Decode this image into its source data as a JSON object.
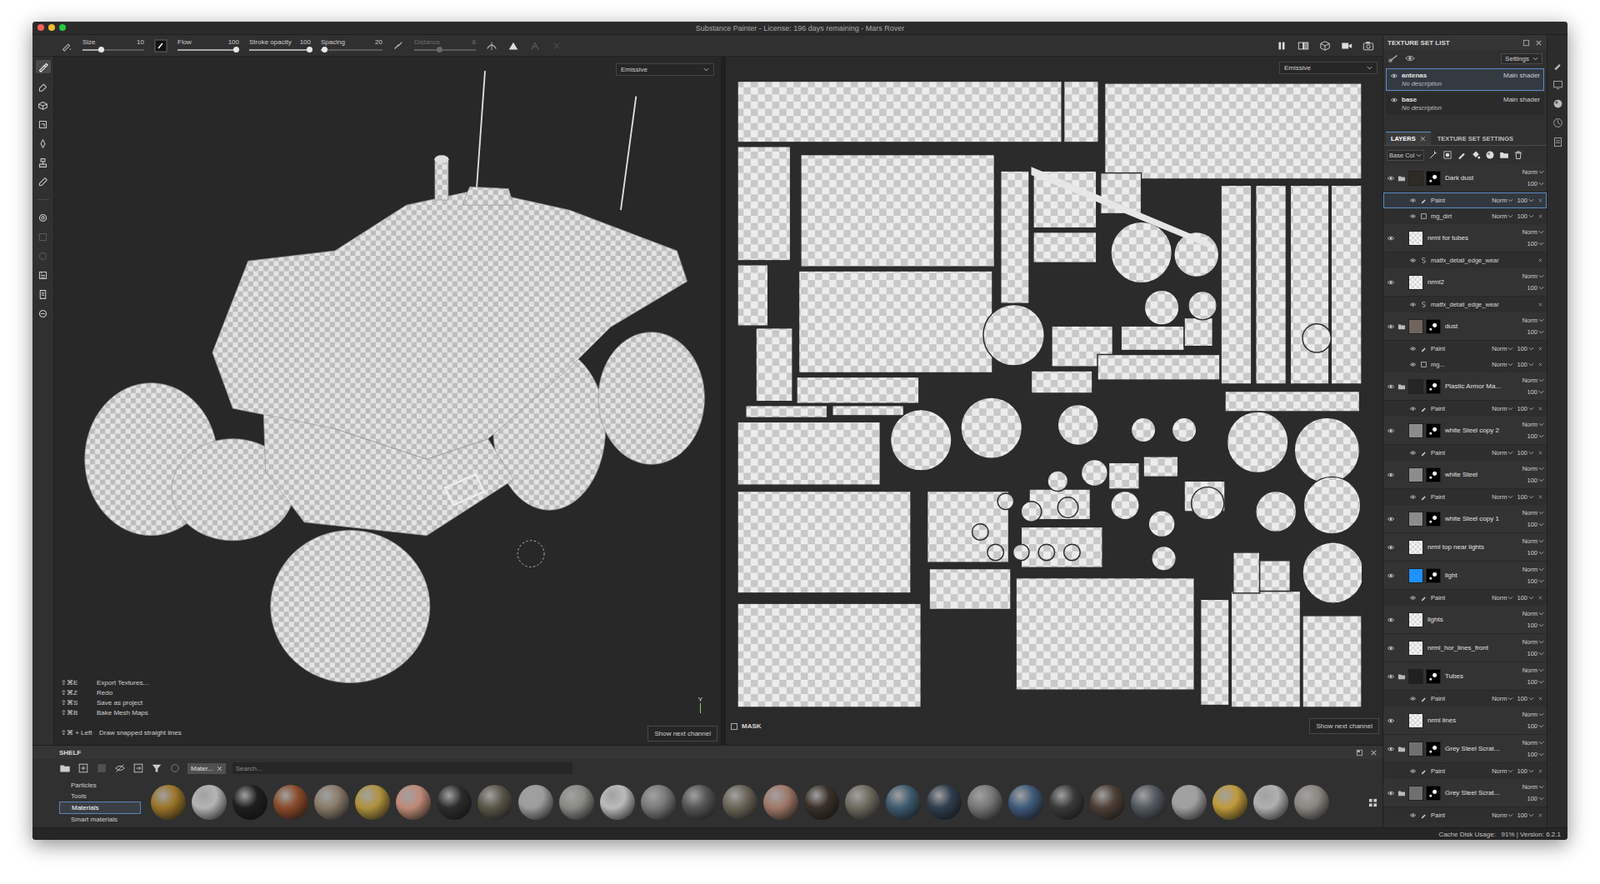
{
  "window": {
    "title": "Substance Painter - License: 196 days remaining - Mars Rover"
  },
  "toolbar": {
    "sliders": [
      {
        "label": "Size",
        "value": "10",
        "level": 0.3,
        "disabled": false
      },
      {
        "label": "Flow",
        "value": "100",
        "level": 0.95,
        "disabled": false
      },
      {
        "label": "Stroke opacity",
        "value": "100",
        "level": 0.97,
        "disabled": false
      },
      {
        "label": "Spacing",
        "value": "20",
        "level": 0.05,
        "disabled": false
      },
      {
        "label": "Distance",
        "value": "8",
        "level": 0.4,
        "disabled": true
      }
    ]
  },
  "tools": [
    {
      "selected": true,
      "disabled": false
    },
    {
      "selected": false,
      "disabled": false
    },
    {
      "selected": false,
      "disabled": false
    },
    {
      "selected": false,
      "disabled": false
    },
    {
      "selected": false,
      "disabled": false
    },
    {
      "selected": false,
      "disabled": false
    },
    {
      "selected": false,
      "disabled": false
    },
    {
      "selected": false,
      "disabled": false
    },
    {
      "selected": false,
      "disabled": true
    },
    {
      "selected": false,
      "disabled": true
    },
    {
      "selected": false,
      "disabled": false
    },
    {
      "selected": false,
      "disabled": false
    },
    {
      "selected": false,
      "disabled": false
    }
  ],
  "viewport3d": {
    "channel": "Emissive",
    "show_next": "Show next channel",
    "axis": "Y",
    "shortcuts": [
      {
        "keys": "⇧⌘E",
        "action": "Export Textures..."
      },
      {
        "keys": "⇧⌘Z",
        "action": "Redo"
      },
      {
        "keys": "⇧⌘S",
        "action": "Save as project"
      },
      {
        "keys": "⇧⌘B",
        "action": "Bake Mesh Maps"
      }
    ],
    "hint": {
      "keys": "⇧⌘ + Left",
      "action": "Draw snapped straight lines"
    }
  },
  "viewport2d": {
    "channel": "Emissive",
    "show_next": "Show next channel",
    "mask": {
      "label": "MASK",
      "checked": false
    }
  },
  "texture_set_list": {
    "title": "TEXTURE SET LIST",
    "settings": "Settings",
    "sets": [
      {
        "name": "antenas",
        "shader": "Main shader",
        "description": "No description",
        "selected": true,
        "visible": true
      },
      {
        "name": "base",
        "shader": "Main shader",
        "description": "No description",
        "selected": false,
        "visible": true
      }
    ]
  },
  "layers_panel": {
    "tabs": [
      {
        "label": "LAYERS",
        "selected": true
      },
      {
        "label": "TEXTURE SET SETTINGS",
        "selected": false
      }
    ],
    "channel": "Base Col",
    "layers": [
      {
        "name": "Dark dust",
        "blend": "Norm",
        "opacity": "100",
        "visible": true,
        "folder": true,
        "color": "#2e2a26",
        "mask": true,
        "children": [
          {
            "kind": "paint",
            "name": "Paint",
            "blend": "Norm",
            "opacity": "100",
            "visible": true,
            "selected": true
          },
          {
            "kind": "mask",
            "name": "mg_dirt",
            "blend": "Norm",
            "opacity": "100",
            "visible": true,
            "selected": false
          }
        ]
      },
      {
        "name": "nrml for tubes",
        "blend": "Norm",
        "opacity": "100",
        "visible": true,
        "folder": false,
        "mask": false,
        "children": [
          {
            "kind": "filter",
            "name": "matfx_detail_edge_wear",
            "visible": true,
            "selected": false
          }
        ]
      },
      {
        "name": "nrml2",
        "blend": "Norm",
        "opacity": "100",
        "visible": true,
        "folder": false,
        "mask": false,
        "children": [
          {
            "kind": "filter",
            "name": "matfx_detail_edge_wear",
            "visible": true,
            "selected": false
          }
        ]
      },
      {
        "name": "dust",
        "blend": "Norm",
        "opacity": "100",
        "visible": true,
        "folder": true,
        "color": "#6e665c",
        "mask": true,
        "children": [
          {
            "kind": "paint",
            "name": "Paint",
            "blend": "Norm",
            "opacity": "100",
            "visible": true,
            "selected": false
          },
          {
            "kind": "mask",
            "name": "mg...",
            "blend": "Norm",
            "opacity": "100",
            "visible": true,
            "selected": false
          }
        ]
      },
      {
        "name": "Plastic Armor Ma...",
        "blend": "Norm",
        "opacity": "100",
        "visible": true,
        "folder": true,
        "color": "#262626",
        "mask": true,
        "children": [
          {
            "kind": "paint",
            "name": "Paint",
            "blend": "Norm",
            "opacity": "100",
            "visible": true,
            "selected": false
          }
        ]
      },
      {
        "name": "white Steel copy 2",
        "blend": "Norm",
        "opacity": "100",
        "visible": true,
        "folder": false,
        "color": "#8c8c8c",
        "mask": true,
        "children": [
          {
            "kind": "paint",
            "name": "Paint",
            "blend": "Norm",
            "opacity": "100",
            "visible": true,
            "selected": false
          }
        ]
      },
      {
        "name": "white Steel",
        "blend": "Norm",
        "opacity": "100",
        "visible": true,
        "folder": false,
        "color": "#8c8c8c",
        "mask": true,
        "children": [
          {
            "kind": "paint",
            "name": "Paint",
            "blend": "Norm",
            "opacity": "100",
            "visible": true,
            "selected": false
          }
        ]
      },
      {
        "name": "white Steel copy 1",
        "blend": "Norm",
        "opacity": "100",
        "visible": true,
        "folder": false,
        "color": "#8c8c8c",
        "mask": true,
        "children": []
      },
      {
        "name": "nrml top near lights",
        "blend": "Norm",
        "opacity": "100",
        "visible": true,
        "folder": false,
        "mask": false,
        "children": []
      },
      {
        "name": "light",
        "blend": "Norm",
        "opacity": "100",
        "visible": true,
        "folder": false,
        "color": "#1e90ff",
        "mask": true,
        "children": [
          {
            "kind": "paint",
            "name": "Paint",
            "blend": "Norm",
            "opacity": "100",
            "visible": true,
            "selected": false
          }
        ]
      },
      {
        "name": "lights",
        "blend": "Norm",
        "opacity": "100",
        "visible": true,
        "folder": false,
        "mask": false,
        "children": []
      },
      {
        "name": "nrml_hor_lines_front",
        "blend": "Norm",
        "opacity": "100",
        "visible": true,
        "folder": false,
        "mask": false,
        "children": []
      },
      {
        "name": "Tubes",
        "blend": "Norm",
        "opacity": "100",
        "visible": true,
        "folder": true,
        "color": "#202020",
        "mask": true,
        "children": [
          {
            "kind": "paint",
            "name": "Paint",
            "blend": "Norm",
            "opacity": "100",
            "visible": true,
            "selected": false
          }
        ]
      },
      {
        "name": "nrml lines",
        "blend": "Norm",
        "opacity": "100",
        "visible": true,
        "folder": false,
        "mask": false,
        "children": []
      },
      {
        "name": "Grey Steel Scrat...",
        "blend": "Norm",
        "opacity": "100",
        "visible": true,
        "folder": true,
        "color": "#707070",
        "mask": true,
        "children": [
          {
            "kind": "paint",
            "name": "Paint",
            "blend": "Norm",
            "opacity": "100",
            "visible": true,
            "selected": false
          }
        ]
      },
      {
        "name": "Grey Steel Scrat...",
        "blend": "Norm",
        "opacity": "100",
        "visible": true,
        "folder": true,
        "color": "#707070",
        "mask": true,
        "children": [
          {
            "kind": "paint",
            "name": "Paint",
            "blend": "Norm",
            "opacity": "100",
            "visible": true,
            "selected": false
          }
        ]
      }
    ]
  },
  "shelf": {
    "title": "SHELF",
    "categories": [
      {
        "label": "Particles",
        "selected": false
      },
      {
        "label": "Tools",
        "selected": false
      },
      {
        "label": "Materials",
        "selected": true
      },
      {
        "label": "Smart materials",
        "selected": false
      }
    ],
    "filter": "Mater...",
    "search_placeholder": "Search...",
    "materials": [
      {
        "color": "#9a7428"
      },
      {
        "color": "#b4b4b4"
      },
      {
        "color": "#1e1e1e"
      },
      {
        "color": "#8a4a2a"
      },
      {
        "color": "#8a7a68"
      },
      {
        "color": "#b0923e"
      },
      {
        "color": "#c08a78"
      },
      {
        "color": "#2c2c2c"
      },
      {
        "color": "#5a5648"
      },
      {
        "color": "#9c9c9c"
      },
      {
        "color": "#8a8a84"
      },
      {
        "color": "#bababa"
      },
      {
        "color": "#7a7a7a"
      },
      {
        "color": "#555555"
      },
      {
        "color": "#6a6456"
      },
      {
        "color": "#a07868"
      },
      {
        "color": "#3a3028"
      },
      {
        "color": "#6e6a5e"
      },
      {
        "color": "#3e5a6e"
      },
      {
        "color": "#2e3e4e"
      },
      {
        "color": "#777777"
      },
      {
        "color": "#3e5a7a"
      },
      {
        "color": "#3a3a3a"
      },
      {
        "color": "#4e4036"
      },
      {
        "color": "#545a62"
      },
      {
        "color": "#a0a0a0"
      },
      {
        "color": "#c09a3a"
      },
      {
        "color": "#b0b0b0"
      },
      {
        "color": "#8a8680"
      }
    ]
  },
  "status_bar": {
    "text": "Cache Disk Usage:   91% | Version: 6.2.1"
  }
}
